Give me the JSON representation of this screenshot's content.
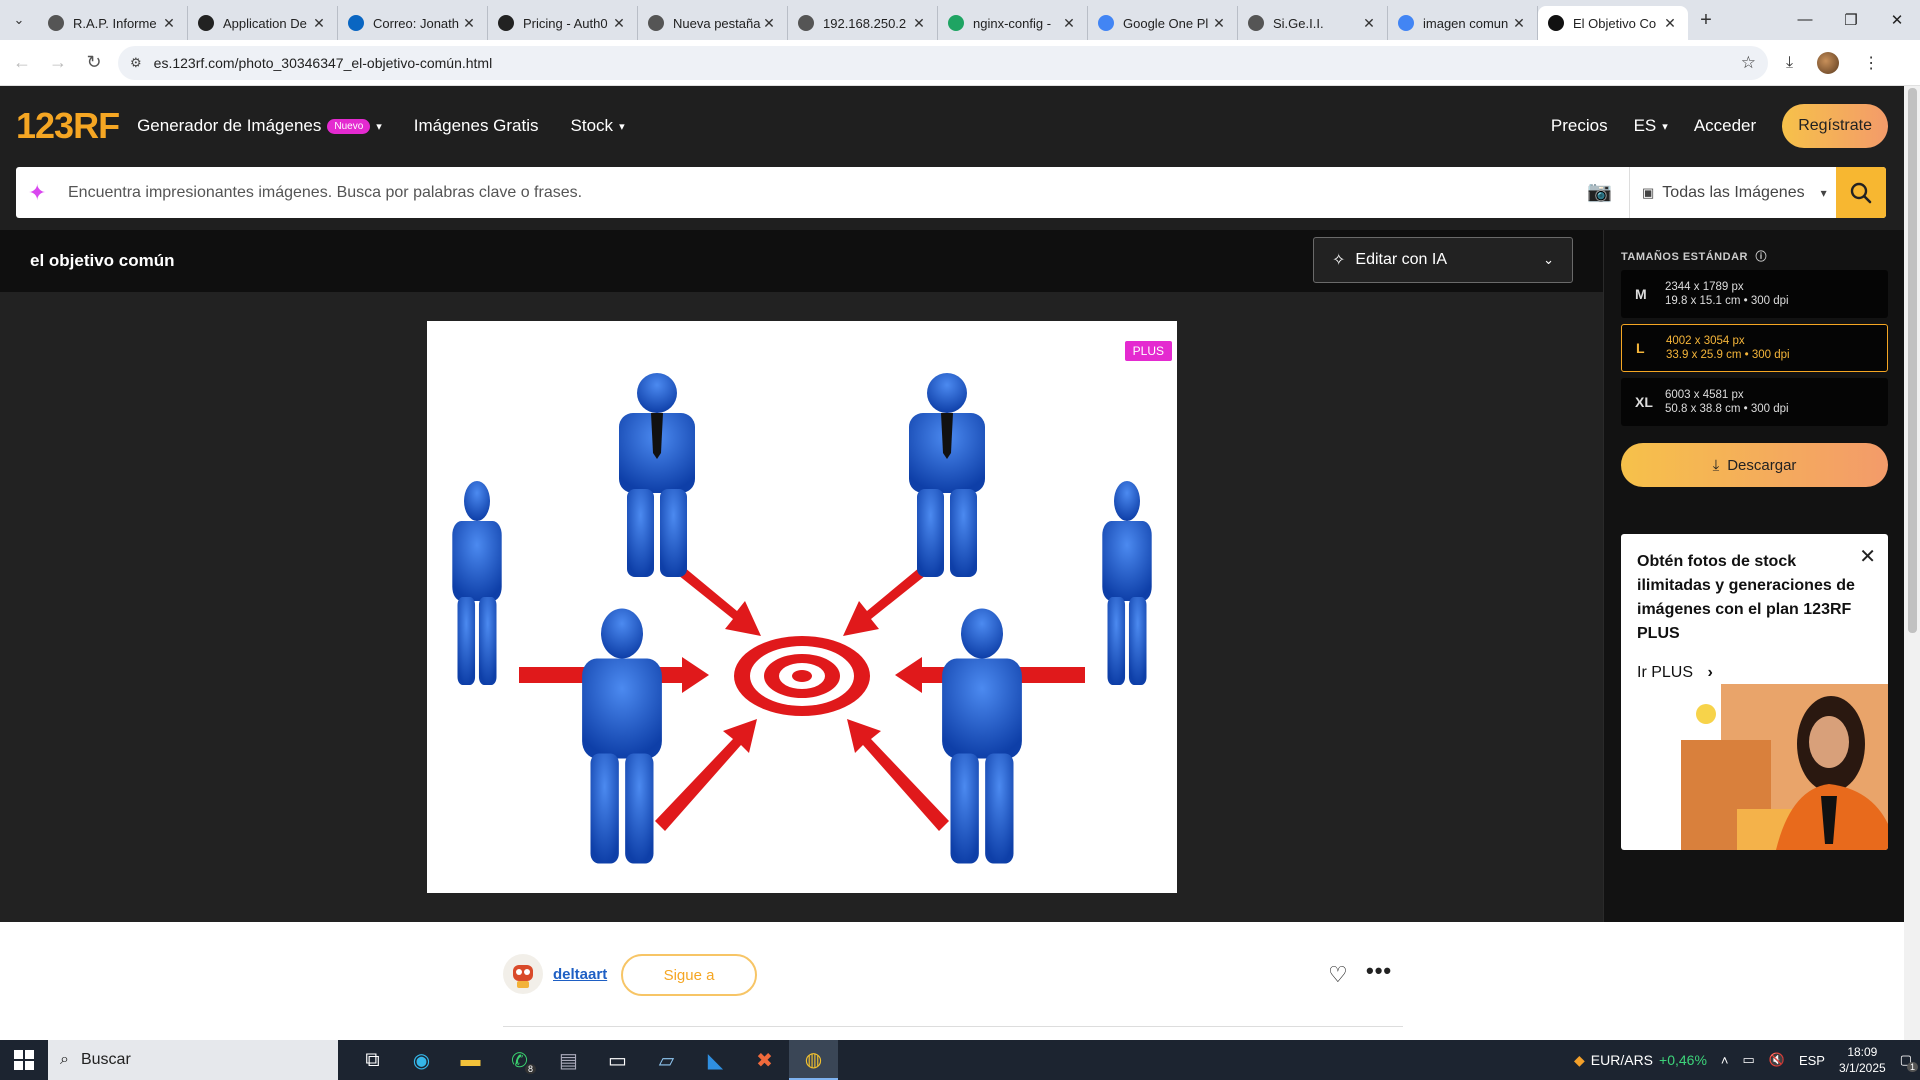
{
  "browser": {
    "tabs": [
      {
        "label": "R.A.P. Informe",
        "icon": "globe-icon",
        "color": "#555555",
        "active": false
      },
      {
        "label": "Application De",
        "icon": "shield-icon",
        "color": "#222222",
        "active": false
      },
      {
        "label": "Correo: Jonath",
        "icon": "outlook-icon",
        "color": "#0a66c2",
        "active": false
      },
      {
        "label": "Pricing - Auth0",
        "icon": "auth0-icon",
        "color": "#222222",
        "active": false
      },
      {
        "label": "Nueva pestaña",
        "icon": "globe-icon",
        "color": "#555555",
        "active": false
      },
      {
        "label": "192.168.250.2",
        "icon": "globe-icon",
        "color": "#555555",
        "active": false
      },
      {
        "label": "nginx-config -",
        "icon": "drive-icon",
        "color": "#1fa463",
        "active": false
      },
      {
        "label": "Google One Pl",
        "icon": "google-one-icon",
        "color": "#4285f4",
        "active": false
      },
      {
        "label": "Si.Ge.I.I.",
        "icon": "globe-icon",
        "color": "#555555",
        "active": false
      },
      {
        "label": "imagen comun",
        "icon": "google-icon",
        "color": "#4285f4",
        "active": false
      },
      {
        "label": "El Objetivo Co",
        "icon": "123rf-icon",
        "color": "#111111",
        "active": true
      }
    ],
    "url": "es.123rf.com/photo_30346347_el-objetivo-común.html"
  },
  "header": {
    "logo": "123RF",
    "nav": [
      {
        "label": "Generador de Imágenes",
        "badge": "Nuevo",
        "dropdown": true
      },
      {
        "label": "Imágenes Gratis",
        "dropdown": false
      },
      {
        "label": "Stock",
        "dropdown": true
      }
    ],
    "pricing": "Precios",
    "language": "ES",
    "login": "Acceder",
    "register": "Regístrate"
  },
  "search": {
    "placeholder": "Encuentra impresionantes imágenes. Busca por palabras clave o frases.",
    "type_select": "Todas las Imágenes"
  },
  "page": {
    "title": "el objetivo común",
    "edit_ai": "Editar con IA",
    "plus_tag": "PLUS"
  },
  "sizes": {
    "title": "TAMAÑOS ESTÁNDAR",
    "options": [
      {
        "code": "M",
        "px": "2344 x 1789 px",
        "cm": "19.8 x 15.1 cm • 300 dpi",
        "selected": false
      },
      {
        "code": "L",
        "px": "4002 x 3054 px",
        "cm": "33.9 x 25.9 cm • 300 dpi",
        "selected": true
      },
      {
        "code": "XL",
        "px": "6003 x 4581 px",
        "cm": "50.8 x 38.8 cm • 300 dpi",
        "selected": false
      }
    ],
    "download": "Descargar"
  },
  "promo": {
    "text": "Obtén fotos de stock ilimitadas y generaciones de imágenes con el plan 123RF PLUS",
    "link": "Ir PLUS"
  },
  "author": {
    "name": "deltaart",
    "follow": "Sigue a"
  },
  "taskbar": {
    "search": "Buscar",
    "whatsapp_badge": "8",
    "ticker_label": "EUR/ARS",
    "ticker_change": "+0,46%",
    "lang": "ESP",
    "time": "18:09",
    "date": "3/1/2025",
    "notif_count": "1"
  },
  "colors": {
    "brand_orange": "#f5a623",
    "plus_pink": "#e42ad0",
    "figure_blue": "#1e63d6",
    "arrow_red": "#e0191b"
  }
}
